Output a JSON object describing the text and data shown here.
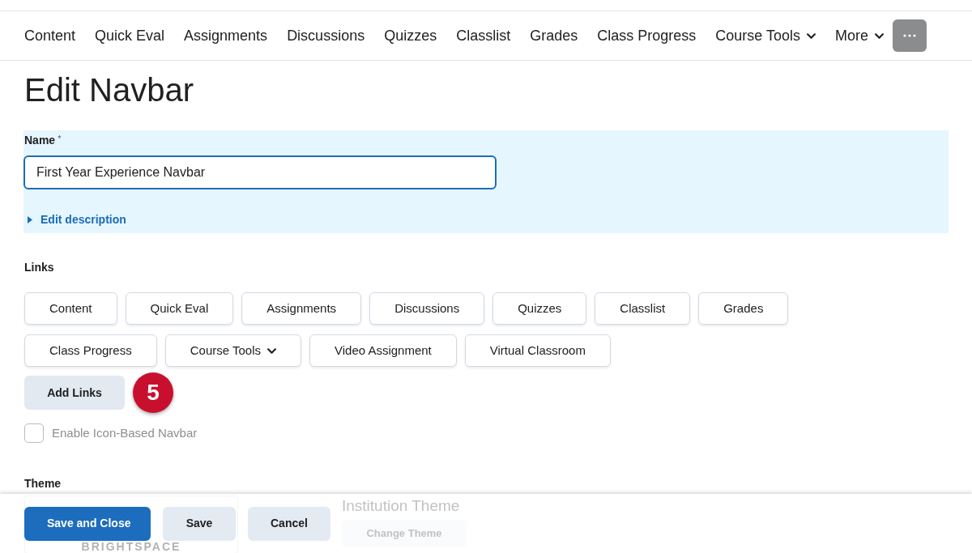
{
  "navbar": {
    "items": [
      {
        "label": "Content",
        "kind": "link"
      },
      {
        "label": "Quick Eval",
        "kind": "link"
      },
      {
        "label": "Assignments",
        "kind": "link"
      },
      {
        "label": "Discussions",
        "kind": "link"
      },
      {
        "label": "Quizzes",
        "kind": "link"
      },
      {
        "label": "Classlist",
        "kind": "link"
      },
      {
        "label": "Grades",
        "kind": "link"
      },
      {
        "label": "Class Progress",
        "kind": "link"
      },
      {
        "label": "Course Tools",
        "kind": "dropdown"
      },
      {
        "label": "More",
        "kind": "dropdown"
      }
    ]
  },
  "page_title": "Edit Navbar",
  "name_field": {
    "label": "Name",
    "required_mark": "*",
    "value": "First Year Experience Navbar",
    "description_toggle": {
      "label": "Edit description",
      "expanded": false
    }
  },
  "links": {
    "label": "Links",
    "items": [
      {
        "label": "Content",
        "kind": "link"
      },
      {
        "label": "Quick Eval",
        "kind": "link"
      },
      {
        "label": "Assignments",
        "kind": "link"
      },
      {
        "label": "Discussions",
        "kind": "link"
      },
      {
        "label": "Quizzes",
        "kind": "link"
      },
      {
        "label": "Classlist",
        "kind": "link"
      },
      {
        "label": "Grades",
        "kind": "link"
      },
      {
        "label": "Class Progress",
        "kind": "link"
      },
      {
        "label": "Course Tools",
        "kind": "dropdown"
      },
      {
        "label": "Video Assignment",
        "kind": "link"
      },
      {
        "label": "Virtual Classroom",
        "kind": "link"
      }
    ],
    "add_button": "Add Links",
    "callout": "5"
  },
  "icon_navbar": {
    "label": "Enable Icon-Based Navbar",
    "checked": false
  },
  "theme": {
    "label": "Theme",
    "logo_text": "BRIGHTSPACE",
    "name": "Institution Theme",
    "change_button": "Change Theme"
  },
  "footer": {
    "buttons": [
      {
        "label": "Save and Close",
        "kind": "primary"
      },
      {
        "label": "Save",
        "kind": "secondary"
      },
      {
        "label": "Cancel",
        "kind": "secondary"
      }
    ]
  }
}
